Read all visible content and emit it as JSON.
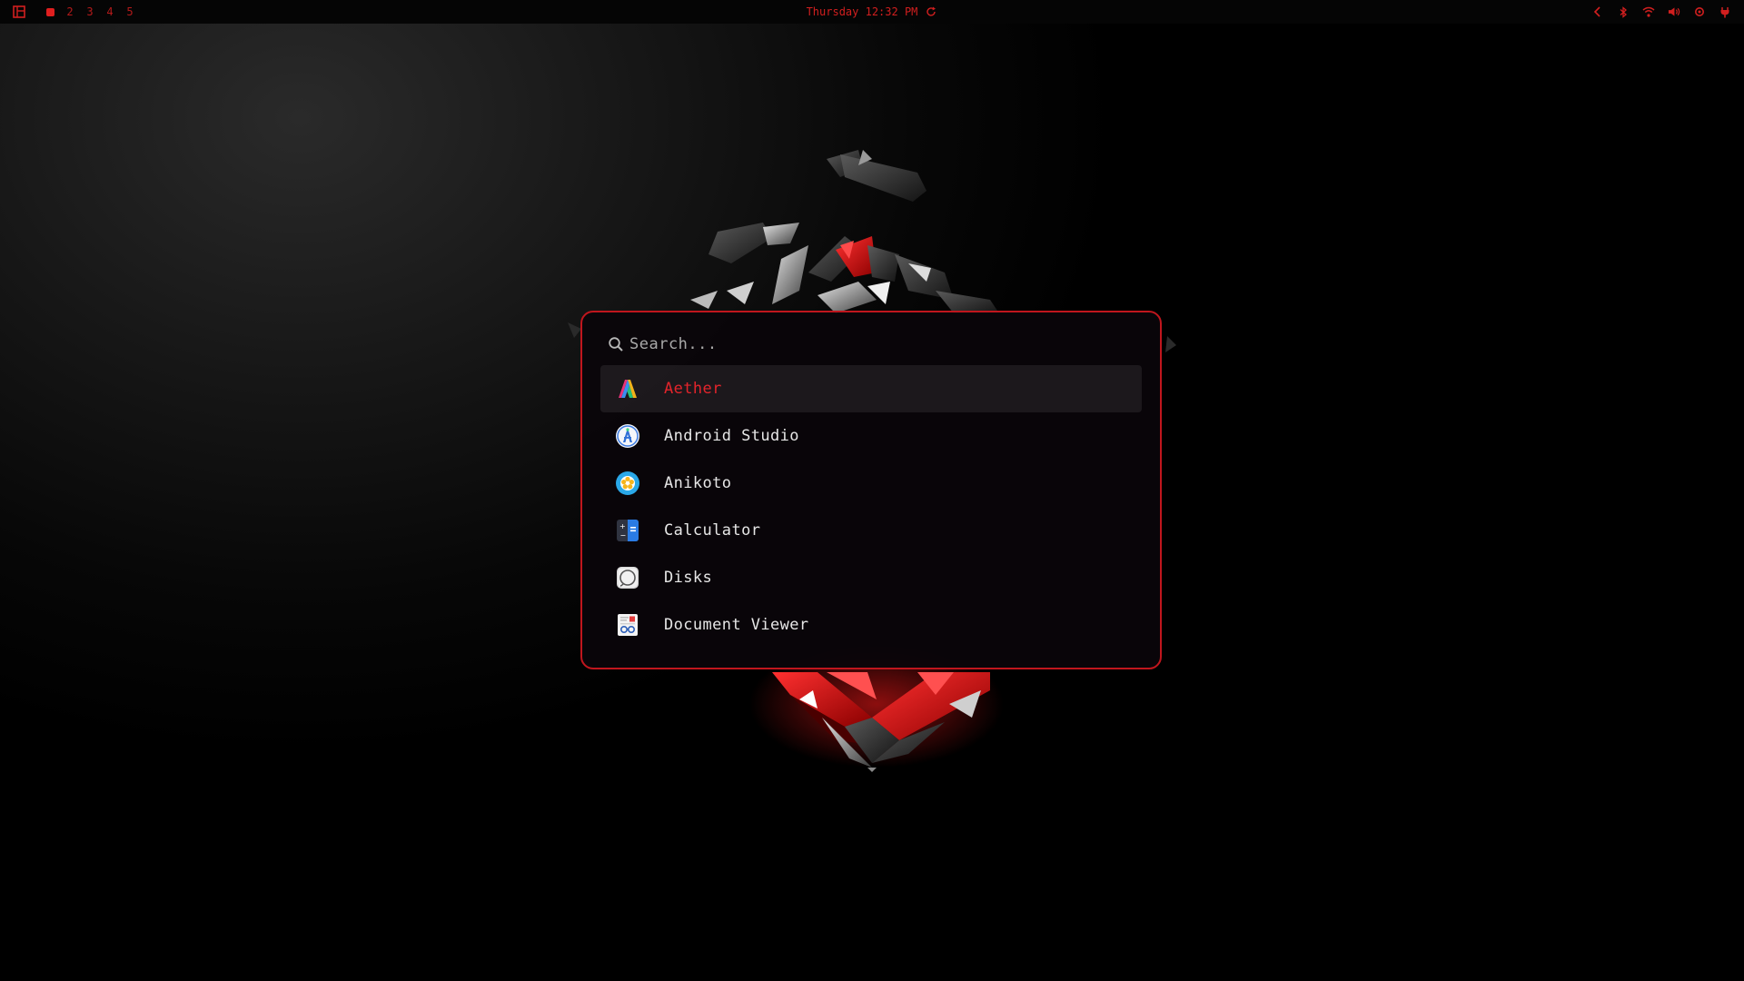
{
  "topbar": {
    "workspaces": [
      {
        "label": "",
        "active": true
      },
      {
        "label": "2",
        "active": false
      },
      {
        "label": "3",
        "active": false
      },
      {
        "label": "4",
        "active": false
      },
      {
        "label": "5",
        "active": false
      }
    ],
    "clock": "Thursday 12:32 PM",
    "tray_icons": [
      "chevron-left-icon",
      "bluetooth-icon",
      "wifi-icon",
      "volume-icon",
      "settings-icon",
      "power-icon"
    ]
  },
  "launcher": {
    "search": {
      "value": "",
      "placeholder": "Search..."
    },
    "results": [
      {
        "label": "Aether",
        "icon": "aether-icon",
        "selected": true
      },
      {
        "label": "Android Studio",
        "icon": "android-studio-icon",
        "selected": false
      },
      {
        "label": "Anikoto",
        "icon": "anikoto-icon",
        "selected": false
      },
      {
        "label": "Calculator",
        "icon": "calculator-icon",
        "selected": false
      },
      {
        "label": "Disks",
        "icon": "disks-icon",
        "selected": false
      },
      {
        "label": "Document Viewer",
        "icon": "document-viewer-icon",
        "selected": false
      }
    ]
  },
  "colors": {
    "accent": "#d21f1f",
    "border": "#c0161d",
    "panel_bg": "#0a050a",
    "text": "#e6e6e6"
  }
}
